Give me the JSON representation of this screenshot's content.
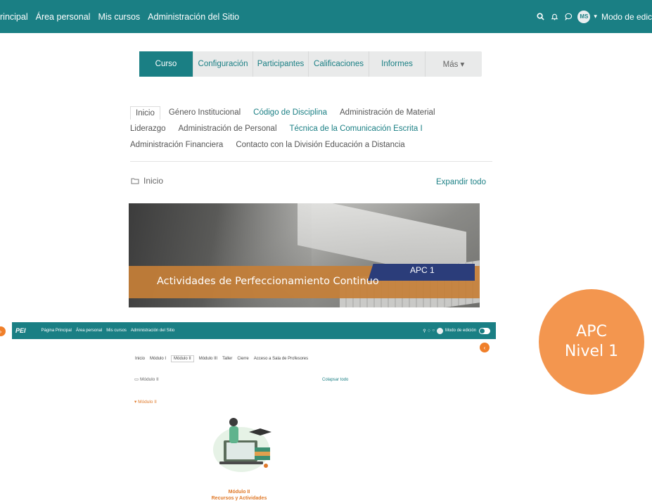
{
  "topbar": {
    "nav": [
      "rincipal",
      "Área personal",
      "Mis cursos",
      "Administración del Sitio"
    ],
    "avatar": "MS",
    "edit_mode": "Modo de edic"
  },
  "course_tabs": [
    "Curso",
    "Configuración",
    "Participantes",
    "Calificaciones",
    "Informes",
    "Más ▾"
  ],
  "sections": {
    "row1": [
      "Inicio",
      "Género Institucional",
      "Código de Disciplina",
      "Administración de Material"
    ],
    "row2": [
      "Liderazgo",
      "Administración de Personal",
      "Técnica de la Comunicación Escrita I"
    ],
    "row3": [
      "Administración Financiera",
      "Contacto con la División Educación a Distancia"
    ]
  },
  "breadcrumb": "Inicio",
  "expand_all": "Expandir todo",
  "banner": {
    "caption": "Actividades de Perfeccionamiento Continuo",
    "tag": "APC 1"
  },
  "second_screenshot": {
    "logo": "PEI",
    "nav": [
      "Página Principal",
      "Área personal",
      "Mis cursos",
      "Administración del Sitio"
    ],
    "edit_mode": "Modo de edición",
    "tabs": [
      "Inicio",
      "Módulo I",
      "Módulo II",
      "Módulo III",
      "Taller",
      "Cierre",
      "Acceso a Sala de Profesores"
    ],
    "breadcrumb": "Módulo II",
    "collapse_all": "Colapsar todo",
    "section_heading": "Módulo II",
    "module_title_1": "Módulo II",
    "module_title_2": "Recursos y Actividades"
  },
  "badge": {
    "line1": "APC",
    "line2": "Nivel 1"
  },
  "colors": {
    "primary": "#1a7f84",
    "badge": "#f3964f",
    "banner_stripe": "#c67f37",
    "banner_tag": "#2b3d7a"
  }
}
